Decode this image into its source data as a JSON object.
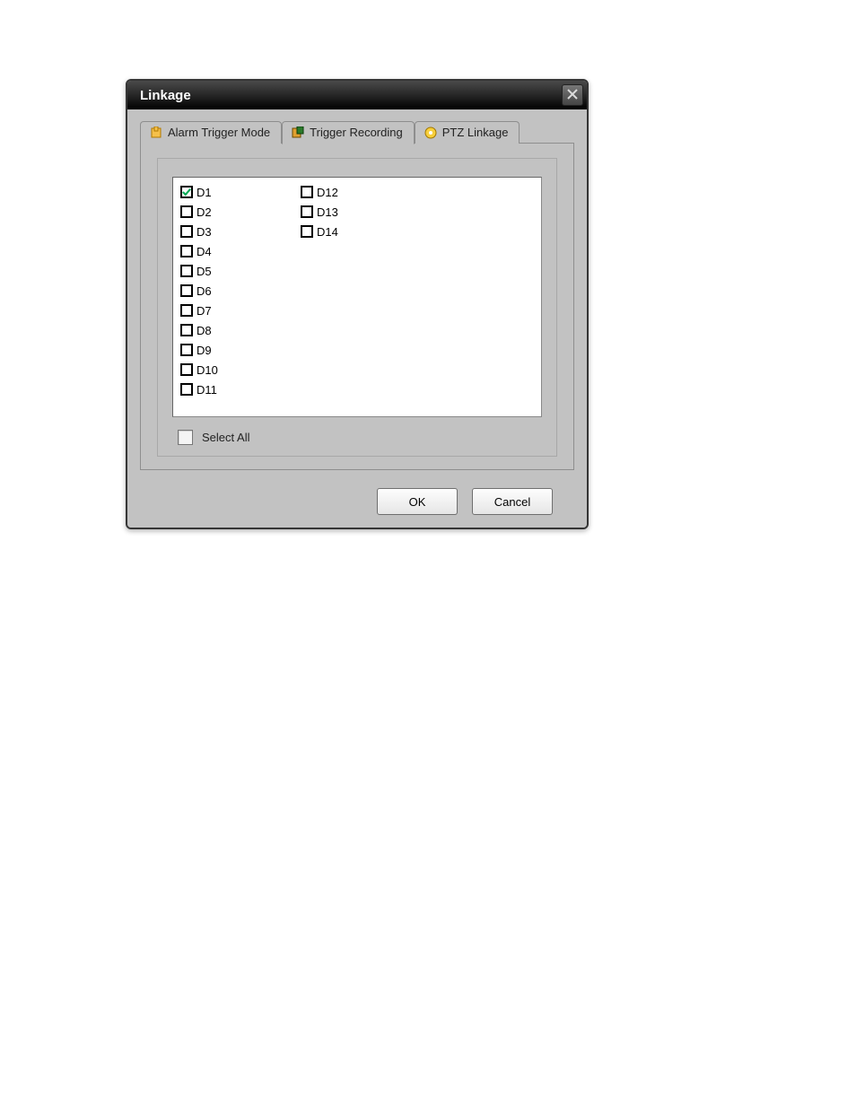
{
  "dialog": {
    "title": "Linkage"
  },
  "tabs": [
    {
      "label": "Alarm Trigger Mode",
      "active": false,
      "icon": "hand-icon"
    },
    {
      "label": "Trigger Recording",
      "active": true,
      "icon": "record-icon"
    },
    {
      "label": "PTZ Linkage",
      "active": false,
      "icon": "ptz-icon"
    }
  ],
  "channels": [
    {
      "label": "D1",
      "checked": true
    },
    {
      "label": "D2",
      "checked": false
    },
    {
      "label": "D3",
      "checked": false
    },
    {
      "label": "D4",
      "checked": false
    },
    {
      "label": "D5",
      "checked": false
    },
    {
      "label": "D6",
      "checked": false
    },
    {
      "label": "D7",
      "checked": false
    },
    {
      "label": "D8",
      "checked": false
    },
    {
      "label": "D9",
      "checked": false
    },
    {
      "label": "D10",
      "checked": false
    },
    {
      "label": "D11",
      "checked": false
    },
    {
      "label": "D12",
      "checked": false
    },
    {
      "label": "D13",
      "checked": false
    },
    {
      "label": "D14",
      "checked": false
    }
  ],
  "select_all": {
    "label": "Select All",
    "checked": false
  },
  "buttons": {
    "ok": "OK",
    "cancel": "Cancel"
  }
}
